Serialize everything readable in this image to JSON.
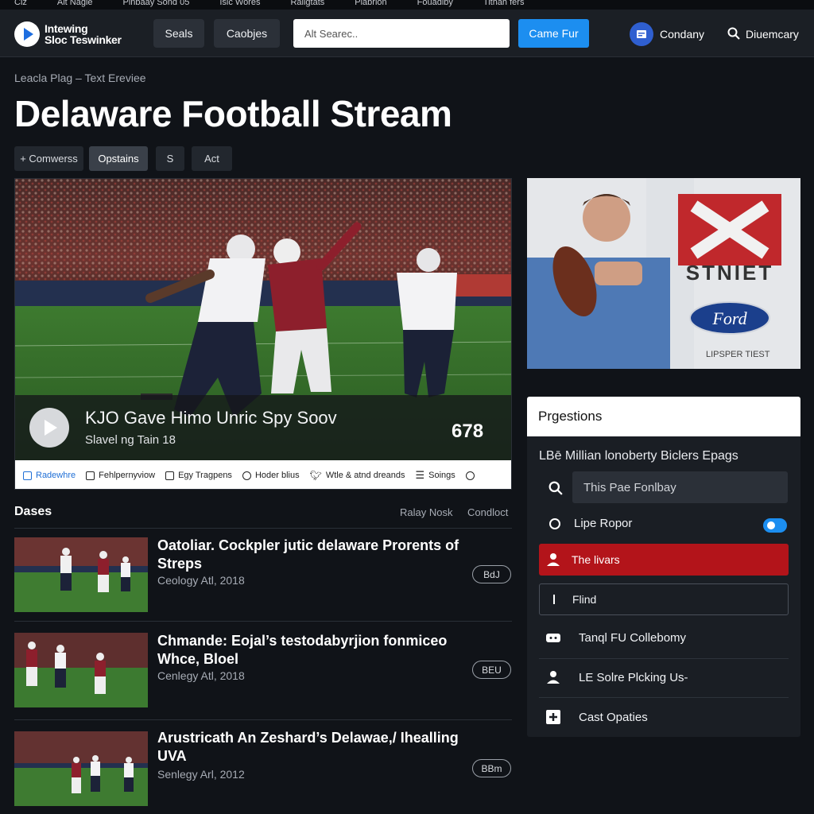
{
  "topbar": {
    "items": [
      "Ciz",
      "Alt Nagie",
      "Pinbaay Sond 05",
      "Isic Wores",
      "Raligtats",
      "Plabrion",
      "Fouadlby",
      "Tithah fers",
      ""
    ]
  },
  "header": {
    "logo_text": "Intewing\nSloc Teswinker",
    "btn_seals": "Seals",
    "btn_caobjes": "Caobjes",
    "search_placeholder": "Alt Searec..",
    "cta_label": "Came Fur",
    "user_label": "Condany",
    "discovery_label": "Diuemcary"
  },
  "breadcrumb": "Leacla Plag – Text Ereviee",
  "page_title": "Delaware Football Stream",
  "chips": [
    "+ Comwerss",
    "Opstains",
    "S",
    "Act"
  ],
  "player": {
    "title": "KJO Gave Himo Unric Spy Soov",
    "subtitle": "Slavel ng Tain 18",
    "count": "678",
    "controls": [
      "Radewhre",
      "Fehlpernyviow",
      "Egy Tragpens",
      "Hoder blius",
      "Wtle & atnd dreands",
      "Soings",
      ""
    ]
  },
  "section": {
    "heading": "Dases",
    "link_a": "Ralay Nosk",
    "link_b": "Condloct"
  },
  "articles": [
    {
      "title": "Oatoliar. Cockpler jutic delaware Prorents of Streps",
      "meta": "Ceology Atl, 2018",
      "badge": "BdJ"
    },
    {
      "title": "Chmande: Eojal’s testodabyrjion fonmiceo Whce, Bloel",
      "meta": "Cenlegy Atl, 2018",
      "badge": "BEU"
    },
    {
      "title": "Arustricath An Zeshard’s Delawae,/ Ihealling UVA",
      "meta": "Senlegy Arl, 2012",
      "badge": "BBm"
    }
  ],
  "panel": {
    "header": "Prgestions",
    "subtitle": "LBē Millian lonoberty Biclers Epags",
    "search_placeholder": "This Pae Fonlbay",
    "row_toggle": "Lipe Ropor",
    "row_red": "The livars",
    "row_box": "Flind",
    "row_collab": "Tanql FU Collebomy",
    "row_picking": "LE Solre Plcking Us-",
    "row_cast": "Cast Opaties"
  },
  "photo": {
    "logo_letters": "STNIET",
    "oval_badge": "Ford",
    "caption": "LIPSPER TIEST"
  },
  "colors": {
    "accent_blue": "#1c8ef0",
    "alert_red": "#b3141a",
    "bg": "#101318"
  }
}
